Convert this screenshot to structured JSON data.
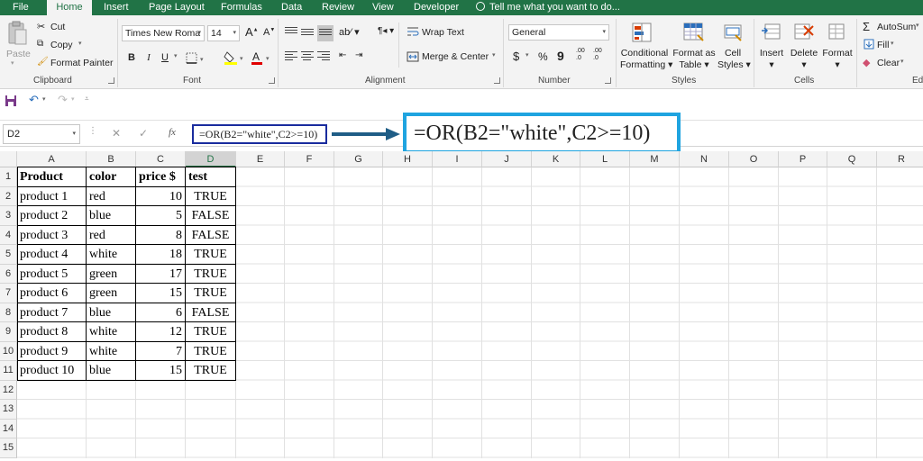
{
  "tabs": [
    "File",
    "Home",
    "Insert",
    "Page Layout",
    "Formulas",
    "Data",
    "Review",
    "View",
    "Developer"
  ],
  "tell_me": "Tell me what you want to do...",
  "ribbon": {
    "clipboard": {
      "paste": "Paste",
      "cut": "Cut",
      "copy": "Copy",
      "format_painter": "Format Painter",
      "label": "Clipboard"
    },
    "font": {
      "name": "Times New Roma",
      "size": "14",
      "bold": "B",
      "italic": "I",
      "underline": "U",
      "label": "Font"
    },
    "alignment": {
      "wrap_text": "Wrap Text",
      "merge_center": "Merge & Center",
      "label": "Alignment"
    },
    "number": {
      "format": "General",
      "currency": "$",
      "percent": "%",
      "comma": "9",
      "inc_decimal": ".00 .0",
      "dec_decimal": ".00 .0",
      "label": "Number"
    },
    "styles": {
      "conditional": "Conditional",
      "formatting": "Formatting",
      "format_as": "Format as",
      "table": "Table",
      "cell": "Cell",
      "cell_styles": "Styles",
      "label": "Styles"
    },
    "cells": {
      "insert": "Insert",
      "delete": "Delete",
      "format": "Format",
      "label": "Cells"
    },
    "editing": {
      "autosum": "AutoSum",
      "fill": "Fill",
      "clear": "Clear",
      "label": "Ed"
    }
  },
  "name_box": "D2",
  "formula": "=OR(B2=\"white\",C2>=10)",
  "formula_big": "=OR(B2=\"white\",C2>=10)",
  "formula_icons": {
    "cancel": "✕",
    "enter": "✓",
    "fx": "fx"
  },
  "columns": [
    "A",
    "B",
    "C",
    "D",
    "E",
    "F",
    "G",
    "H",
    "I",
    "J",
    "K",
    "L",
    "M",
    "N",
    "O",
    "P",
    "Q",
    "R"
  ],
  "rows": [
    "1",
    "2",
    "3",
    "4",
    "5",
    "6",
    "7",
    "8",
    "9",
    "10",
    "11",
    "12",
    "13",
    "14",
    "15"
  ],
  "table": {
    "headers": [
      "Product",
      "color",
      "price $",
      "test"
    ],
    "data": [
      [
        "product 1",
        "red",
        "10",
        "TRUE"
      ],
      [
        "product 2",
        "blue",
        "5",
        "FALSE"
      ],
      [
        "product 3",
        "red",
        "8",
        "FALSE"
      ],
      [
        "product 4",
        "white",
        "18",
        "TRUE"
      ],
      [
        "product 5",
        "green",
        "17",
        "TRUE"
      ],
      [
        "product 6",
        "green",
        "15",
        "TRUE"
      ],
      [
        "product 7",
        "blue",
        "6",
        "FALSE"
      ],
      [
        "product 8",
        "white",
        "12",
        "TRUE"
      ],
      [
        "product 9",
        "white",
        "7",
        "TRUE"
      ],
      [
        "product 10",
        "blue",
        "15",
        "TRUE"
      ]
    ]
  },
  "colors": {
    "excel_green": "#217346",
    "callout_blue": "#1fa4e0",
    "box_navy": "#1a2c9e",
    "arrow": "#1f5d86"
  }
}
